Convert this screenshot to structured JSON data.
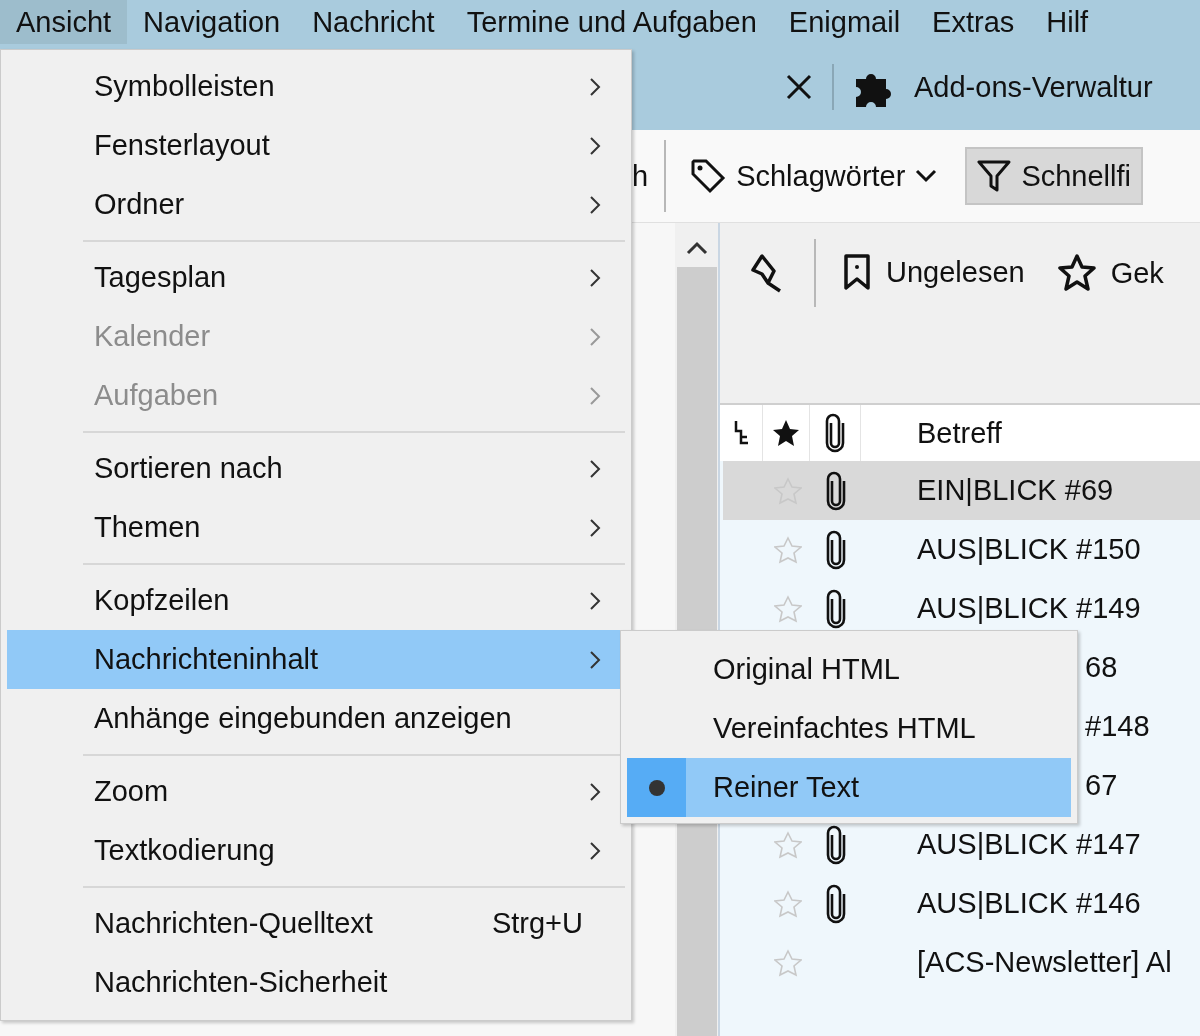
{
  "menubar": [
    {
      "label": "Ansicht",
      "selected": true
    },
    {
      "label": "Navigation",
      "selected": false
    },
    {
      "label": "Nachricht",
      "selected": false
    },
    {
      "label": "Termine und Aufgaben",
      "selected": false
    },
    {
      "label": "Enigmail",
      "selected": false
    },
    {
      "label": "Extras",
      "selected": false
    },
    {
      "label": "Hilf",
      "selected": false
    }
  ],
  "tabbar": {
    "addons_tab": "Add-ons-Verwaltur"
  },
  "toolbar": {
    "cut_label": "h",
    "tags_button": "Schlagwörter",
    "quickfilter_button": "Schnellfi"
  },
  "quickfilter": {
    "unread": "Ungelesen",
    "starred": "Gek"
  },
  "thread_header": {
    "subject": "Betreff"
  },
  "rows": [
    {
      "subject": "EIN|BLICK #69",
      "attachment": true,
      "selected": true,
      "covered": false
    },
    {
      "subject": "AUS|BLICK #150",
      "attachment": true,
      "selected": false,
      "covered": false
    },
    {
      "subject": "AUS|BLICK #149",
      "attachment": true,
      "selected": false,
      "covered": false
    },
    {
      "subject": "68",
      "selected": false,
      "covered": true
    },
    {
      "subject": "#148",
      "selected": false,
      "covered": true
    },
    {
      "subject": "67",
      "selected": false,
      "covered": true
    },
    {
      "subject": "AUS|BLICK #147",
      "attachment": true,
      "selected": false,
      "covered": false
    },
    {
      "subject": "AUS|BLICK #146",
      "attachment": true,
      "selected": false,
      "covered": false
    },
    {
      "subject": "[ACS-Newsletter] Al",
      "attachment": false,
      "selected": false,
      "covered": false
    }
  ],
  "menu": [
    {
      "kind": "item",
      "label": "Symbolleisten",
      "submenu": true,
      "disabled": false,
      "selected": false
    },
    {
      "kind": "item",
      "label": "Fensterlayout",
      "submenu": true,
      "disabled": false,
      "selected": false
    },
    {
      "kind": "item",
      "label": "Ordner",
      "submenu": true,
      "disabled": false,
      "selected": false
    },
    {
      "kind": "separator"
    },
    {
      "kind": "item",
      "label": "Tagesplan",
      "submenu": true,
      "disabled": false,
      "selected": false
    },
    {
      "kind": "item",
      "label": "Kalender",
      "submenu": true,
      "disabled": true,
      "selected": false
    },
    {
      "kind": "item",
      "label": "Aufgaben",
      "submenu": true,
      "disabled": true,
      "selected": false
    },
    {
      "kind": "separator"
    },
    {
      "kind": "item",
      "label": "Sortieren nach",
      "submenu": true,
      "disabled": false,
      "selected": false
    },
    {
      "kind": "item",
      "label": "Themen",
      "submenu": true,
      "disabled": false,
      "selected": false
    },
    {
      "kind": "separator"
    },
    {
      "kind": "item",
      "label": "Kopfzeilen",
      "submenu": true,
      "disabled": false,
      "selected": false
    },
    {
      "kind": "item",
      "label": "Nachrichteninhalt",
      "submenu": true,
      "disabled": false,
      "selected": true
    },
    {
      "kind": "item",
      "label": "Anhänge eingebunden anzeigen",
      "submenu": false,
      "disabled": false,
      "selected": false
    },
    {
      "kind": "separator"
    },
    {
      "kind": "item",
      "label": "Zoom",
      "submenu": true,
      "disabled": false,
      "selected": false
    },
    {
      "kind": "item",
      "label": "Textkodierung",
      "submenu": true,
      "disabled": false,
      "selected": false
    },
    {
      "kind": "separator"
    },
    {
      "kind": "item",
      "label": "Nachrichten-Quelltext",
      "shortcut": "Strg+U",
      "submenu": false,
      "disabled": false,
      "selected": false
    },
    {
      "kind": "item",
      "label": "Nachrichten-Sicherheit",
      "submenu": false,
      "disabled": false,
      "selected": false
    }
  ],
  "submenu": [
    {
      "label": "Original HTML",
      "checked": false,
      "selected": false
    },
    {
      "label": "Vereinfachtes HTML",
      "checked": false,
      "selected": false
    },
    {
      "label": "Reiner Text",
      "checked": true,
      "selected": true
    }
  ]
}
